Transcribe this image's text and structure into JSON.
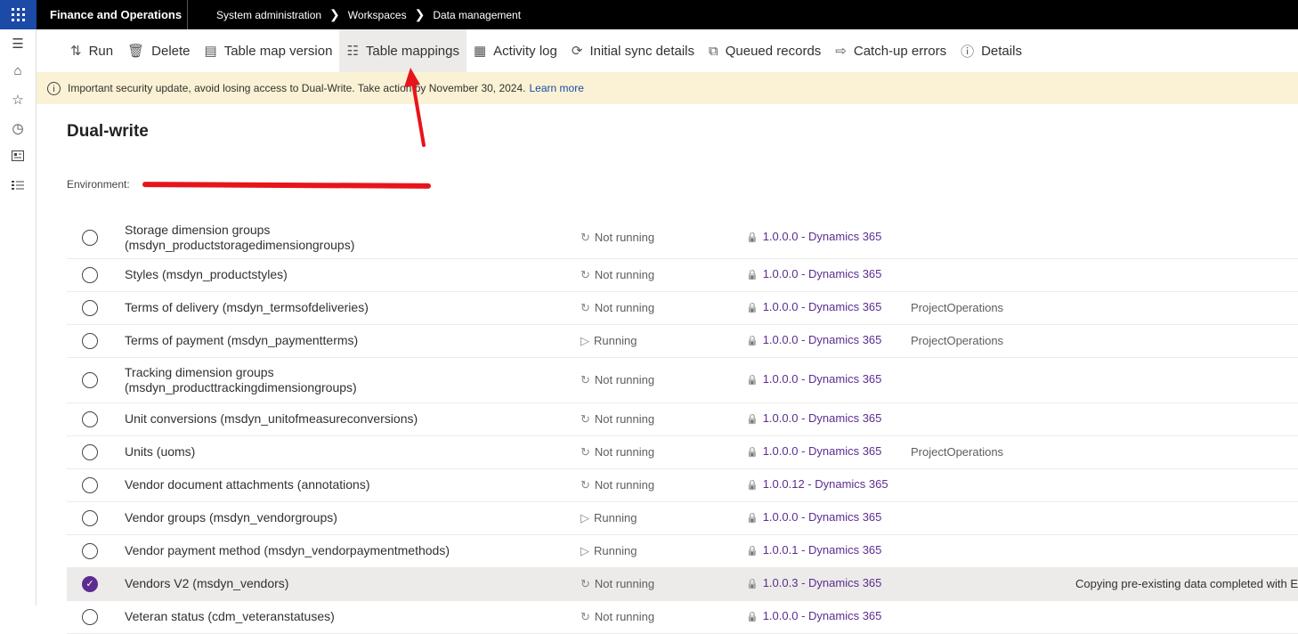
{
  "topbar": {
    "app_name": "Finance and Operations",
    "breadcrumbs": [
      "System administration",
      "Workspaces",
      "Data management"
    ]
  },
  "leftnav": {
    "icons": [
      "hamburger-icon",
      "home-icon",
      "star-icon",
      "clock-icon",
      "workspace-icon",
      "list-icon"
    ]
  },
  "toolbar": {
    "buttons": [
      {
        "label": "Run",
        "icon": "sort-icon"
      },
      {
        "label": "Delete",
        "icon": "trash-icon"
      },
      {
        "label": "Table map version",
        "icon": "table-icon"
      },
      {
        "label": "Table mappings",
        "icon": "document-icon"
      },
      {
        "label": "Activity log",
        "icon": "log-icon"
      },
      {
        "label": "Initial sync details",
        "icon": "sync-icon"
      },
      {
        "label": "Queued records",
        "icon": "queue-icon"
      },
      {
        "label": "Catch-up errors",
        "icon": "error-icon"
      },
      {
        "label": "Details",
        "icon": "info-icon"
      }
    ]
  },
  "banner": {
    "text": "Important security update, avoid losing access to Dual-Write. Take action by November 30, 2024.",
    "link": "Learn more"
  },
  "page": {
    "title": "Dual-write",
    "environment_label": "Environment:"
  },
  "rows": [
    {
      "name_line1": "Storage dimension groups",
      "name_line2": "(msdyn_productstoragedimensiongroups)",
      "status": "Not running",
      "version": "1.0.0.0 - Dynamics 365",
      "project": "",
      "message": ""
    },
    {
      "name_line1": "Styles (msdyn_productstyles)",
      "name_line2": "",
      "status": "Not running",
      "version": "1.0.0.0 - Dynamics 365",
      "project": "",
      "message": ""
    },
    {
      "name_line1": "Terms of delivery (msdyn_termsofdeliveries)",
      "name_line2": "",
      "status": "Not running",
      "version": "1.0.0.0 - Dynamics 365",
      "project": "ProjectOperations",
      "message": ""
    },
    {
      "name_line1": "Terms of payment (msdyn_paymentterms)",
      "name_line2": "",
      "status": "Running",
      "version": "1.0.0.0 - Dynamics 365",
      "project": "ProjectOperations",
      "message": ""
    },
    {
      "name_line1": "Tracking dimension groups",
      "name_line2": "(msdyn_producttrackingdimensiongroups)",
      "status": "Not running",
      "version": "1.0.0.0 - Dynamics 365",
      "project": "",
      "message": ""
    },
    {
      "name_line1": "Unit conversions (msdyn_unitofmeasureconversions)",
      "name_line2": "",
      "status": "Not running",
      "version": "1.0.0.0 - Dynamics 365",
      "project": "",
      "message": ""
    },
    {
      "name_line1": "Units (uoms)",
      "name_line2": "",
      "status": "Not running",
      "version": "1.0.0.0 - Dynamics 365",
      "project": "ProjectOperations",
      "message": ""
    },
    {
      "name_line1": "Vendor document attachments (annotations)",
      "name_line2": "",
      "status": "Not running",
      "version": "1.0.0.12 - Dynamics 365",
      "project": "",
      "message": ""
    },
    {
      "name_line1": "Vendor groups (msdyn_vendorgroups)",
      "name_line2": "",
      "status": "Running",
      "version": "1.0.0.0 - Dynamics 365",
      "project": "",
      "message": ""
    },
    {
      "name_line1": "Vendor payment method (msdyn_vendorpaymentmethods)",
      "name_line2": "",
      "status": "Running",
      "version": "1.0.0.1 - Dynamics 365",
      "project": "",
      "message": ""
    },
    {
      "name_line1": "Vendors V2 (msdyn_vendors)",
      "name_line2": "",
      "status": "Not running",
      "version": "1.0.0.3 - Dynamics 365",
      "project": "",
      "message": "Copying pre-existing data completed with E",
      "selected": true
    },
    {
      "name_line1": "Veteran status (cdm_veteranstatuses)",
      "name_line2": "",
      "status": "Not running",
      "version": "1.0.0.0 - Dynamics 365",
      "project": "",
      "message": ""
    }
  ],
  "colors": {
    "brand": "#1c4aa7",
    "accent": "#5c2d91",
    "banner_bg": "#fbf2d5",
    "annotation": "#e8141c"
  }
}
